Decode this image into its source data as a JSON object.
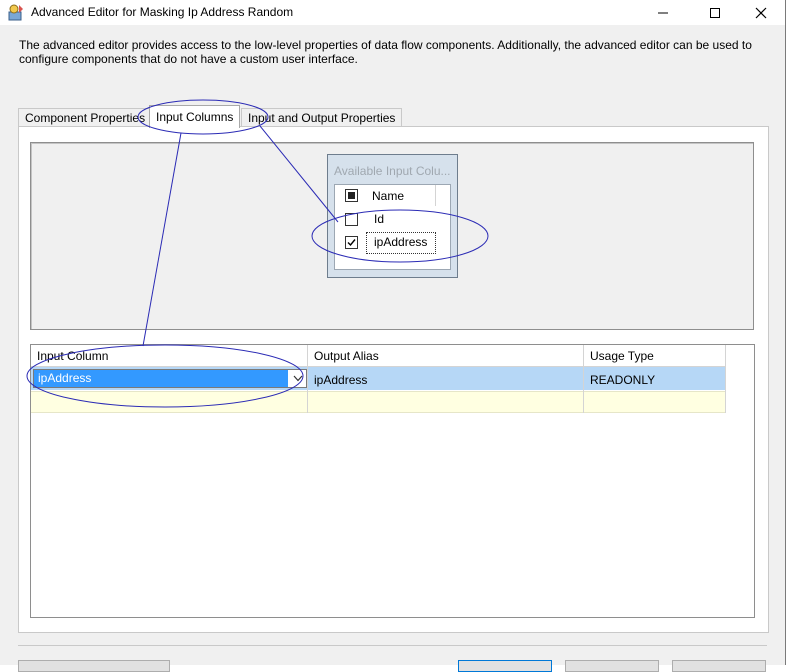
{
  "window": {
    "title": "Advanced Editor for Masking Ip Address Random",
    "minimize_glyph": "—",
    "maximize_glyph": "☐",
    "close_glyph": "✕"
  },
  "description": "The advanced editor provides access to the low-level properties of data flow components. Additionally, the advanced editor can be used to configure components that do not have a custom user interface.",
  "tabs": [
    {
      "label": "Component Properties",
      "selected": false
    },
    {
      "label": "Input Columns",
      "selected": true
    },
    {
      "label": "Input and Output Properties",
      "selected": false
    }
  ],
  "available_columns": {
    "header": "Available Input Colu...",
    "name_header": "Name",
    "select_all_state": "indeterminate",
    "items": [
      {
        "label": "Id",
        "checked": false
      },
      {
        "label": "ipAddress",
        "checked": true
      }
    ]
  },
  "grid": {
    "columns": [
      "Input Column",
      "Output Alias",
      "Usage Type"
    ],
    "rows": [
      {
        "input_column": "ipAddress",
        "output_alias": "ipAddress",
        "usage_type": "READONLY"
      }
    ]
  },
  "icons": {
    "app": "ssis-editor-icon",
    "dropdown": "chevron-down-icon"
  },
  "colors": {
    "selection": "#3399ff",
    "row_highlight": "#b6d7f6",
    "new_row": "#ffffe1",
    "annotation": "#2b2bb5"
  }
}
